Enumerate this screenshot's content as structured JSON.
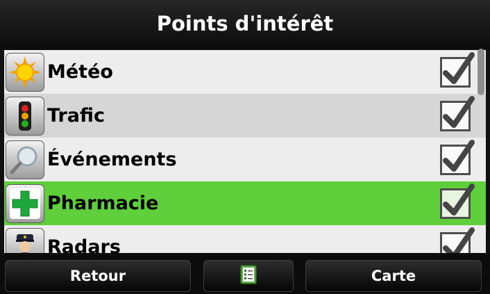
{
  "header": {
    "title": "Points d'intérêt"
  },
  "items": [
    {
      "label": "Météo",
      "icon": "sun-icon",
      "checked": true
    },
    {
      "label": "Trafic",
      "icon": "traffic-light-icon",
      "checked": true
    },
    {
      "label": "Événements",
      "icon": "magnifier-icon",
      "checked": true
    },
    {
      "label": "Pharmacie",
      "icon": "pharmacy-cross-icon",
      "checked": true,
      "selected": true
    },
    {
      "label": "Radars",
      "icon": "police-officer-icon",
      "checked": true
    }
  ],
  "footer": {
    "back_label": "Retour",
    "list_icon": "checklist-icon",
    "map_label": "Carte"
  },
  "colors": {
    "selected_row": "#5fcf3b",
    "alt_row": "#d6d6d6",
    "row": "#ededed"
  }
}
